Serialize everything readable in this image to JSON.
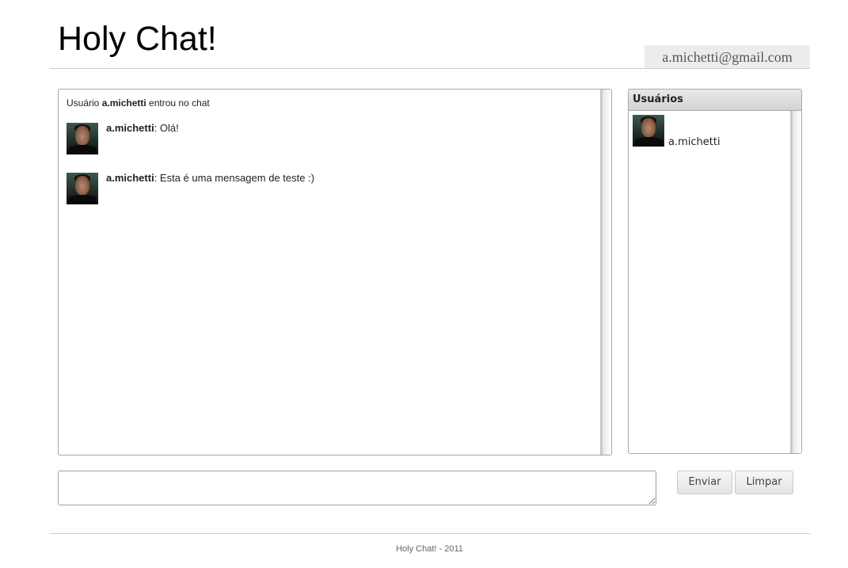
{
  "header": {
    "title": "Holy Chat!",
    "user_email": "a.michetti@gmail.com"
  },
  "chat": {
    "system_message": {
      "prefix": "Usuário ",
      "user": "a.michetti",
      "suffix": " entrou no chat"
    },
    "messages": [
      {
        "author": "a.michetti",
        "separator": ": ",
        "text": "Olá!"
      },
      {
        "author": "a.michetti",
        "separator": ": ",
        "text": "Esta é uma mensagem de teste :)"
      }
    ]
  },
  "users_panel": {
    "title": "Usuários",
    "users": [
      {
        "name": "a.michetti"
      }
    ]
  },
  "composer": {
    "value": "",
    "send_label": "Enviar",
    "clear_label": "Limpar"
  },
  "footer": {
    "text": "Holy Chat! - 2011"
  }
}
